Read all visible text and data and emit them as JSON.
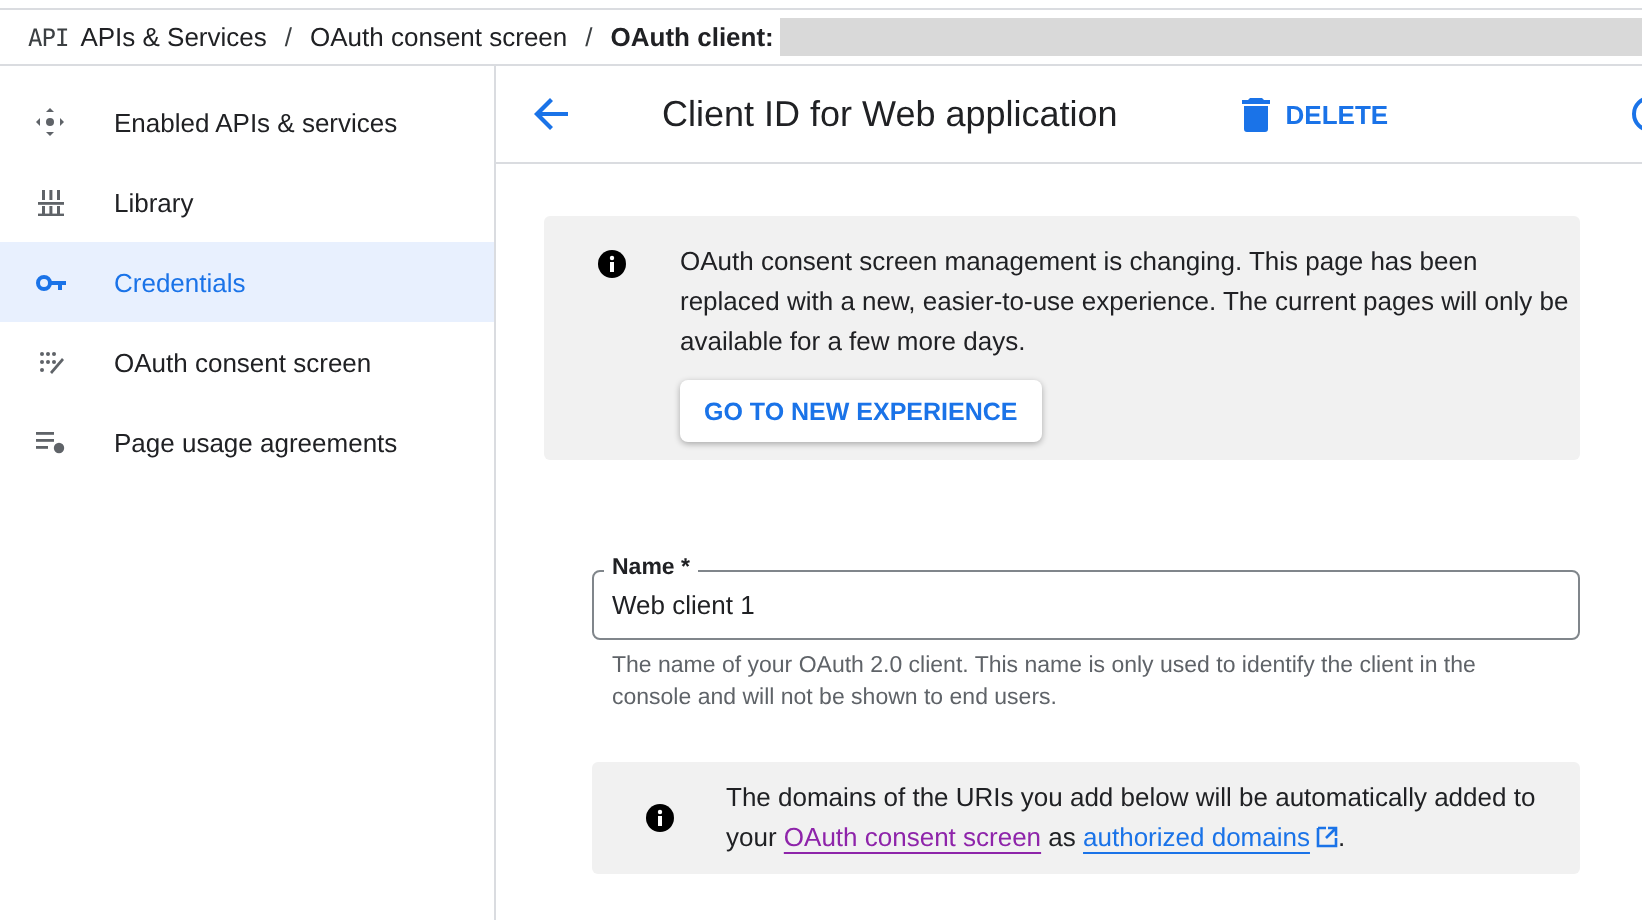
{
  "breadcrumb": {
    "logo": "API",
    "items": [
      {
        "label": "APIs & Services",
        "current": false
      },
      {
        "label": "OAuth consent screen",
        "current": false
      },
      {
        "label": "OAuth client:",
        "current": true
      }
    ],
    "separator": "/"
  },
  "sidebar": {
    "items": [
      {
        "label": "Enabled APIs & services",
        "selected": false
      },
      {
        "label": "Library",
        "selected": false
      },
      {
        "label": "Credentials",
        "selected": true
      },
      {
        "label": "OAuth consent screen",
        "selected": false
      },
      {
        "label": "Page usage agreements",
        "selected": false
      }
    ]
  },
  "header": {
    "title": "Client ID for Web application",
    "delete_label": "DELETE"
  },
  "notice": {
    "text": "OAuth consent screen management is changing. This page has been replaced with a new, easier-to-use experience. The current pages will only be available for a few more days.",
    "button": "GO TO NEW EXPERIENCE"
  },
  "name_field": {
    "label": "Name *",
    "value": "Web client 1",
    "helper": "The name of your OAuth 2.0 client. This name is only used to identify the client in the console and will not be shown to end users."
  },
  "domains_notice": {
    "segments": [
      {
        "kind": "text",
        "text": "The domains of the URIs you add below will be automatically added to your "
      },
      {
        "kind": "link",
        "text": "OAuth consent screen",
        "visited": true,
        "external": false
      },
      {
        "kind": "text",
        "text": " as "
      },
      {
        "kind": "link",
        "text": "authorized domains",
        "visited": false,
        "external": true
      },
      {
        "kind": "text",
        "text": "."
      }
    ]
  }
}
